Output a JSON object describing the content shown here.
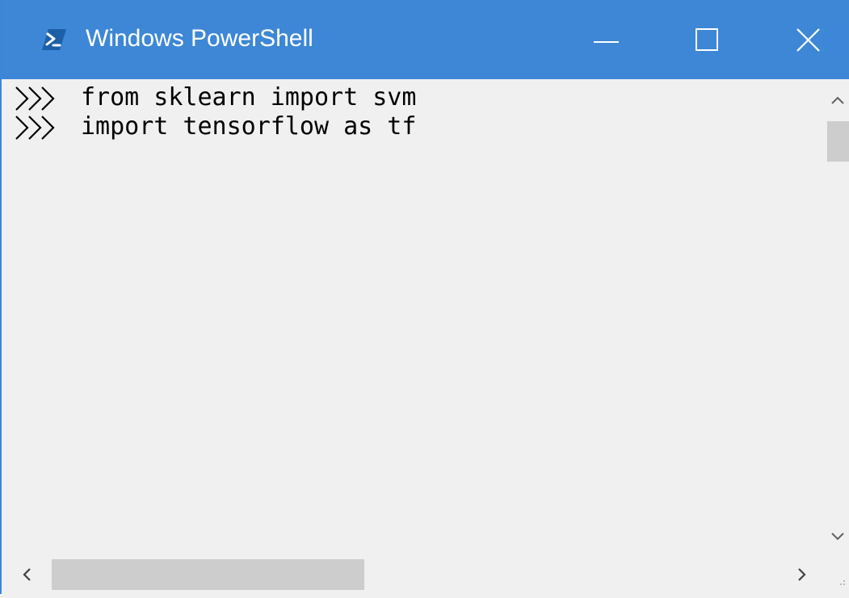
{
  "window": {
    "title": "Windows PowerShell",
    "app_icon": "powershell-icon",
    "titlebar_color": "#3d87d6",
    "controls": [
      "minimize-icon",
      "maximize-icon",
      "close-icon"
    ]
  },
  "console": {
    "background": "#f0f0f0",
    "text_color": "#000000",
    "lines": [
      {
        "prompt_icon": "prompt-chevrons-icon",
        "text": "from sklearn import svm"
      },
      {
        "prompt_icon": "prompt-chevrons-icon",
        "text": "import tensorflow as tf"
      }
    ]
  },
  "scrollbars": {
    "vertical_icons": [
      "chevron-up-icon",
      "chevron-down-icon"
    ],
    "horizontal_icons": [
      "chevron-left-icon",
      "chevron-right-icon"
    ],
    "corner_icon": "resize-grip-icon"
  }
}
